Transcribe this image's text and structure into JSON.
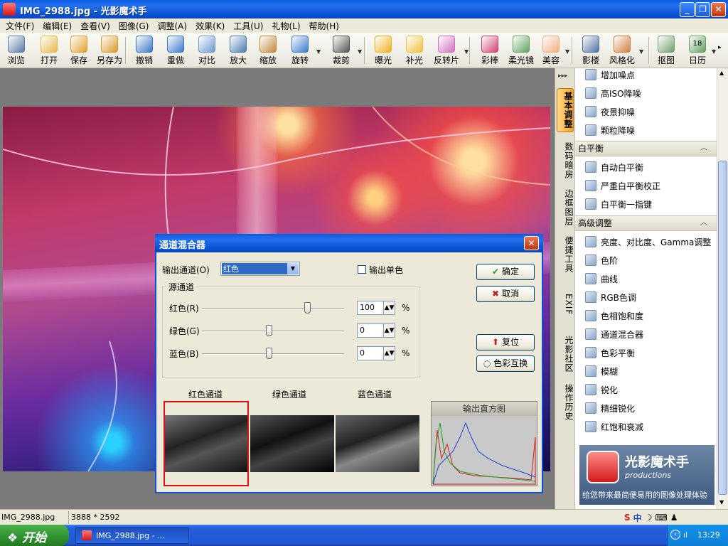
{
  "window": {
    "title": "IMG_2988.jpg - 光影魔术手",
    "min": "_",
    "max": "❐",
    "close": "✕"
  },
  "menu": [
    "文件(F)",
    "编辑(E)",
    "查看(V)",
    "图像(G)",
    "调整(A)",
    "效果(K)",
    "工具(U)",
    "礼物(L)",
    "帮助(H)"
  ],
  "toolbar": [
    {
      "label": "浏览",
      "icon": "eye-icon",
      "color": "#5a7aa8"
    },
    {
      "label": "打开",
      "icon": "folder-icon",
      "color": "#e8b84a"
    },
    {
      "label": "保存",
      "icon": "save-icon",
      "color": "#e0a030"
    },
    {
      "label": "另存为",
      "icon": "save-as-icon",
      "color": "#d89a28"
    },
    {
      "label": "撤销",
      "icon": "undo-icon",
      "color": "#3a78c8"
    },
    {
      "label": "重做",
      "icon": "redo-icon",
      "color": "#3a78c8"
    },
    {
      "label": "对比",
      "icon": "compare-icon",
      "color": "#6a9ad0"
    },
    {
      "label": "放大",
      "icon": "zoom-in-icon",
      "color": "#4a7ab0"
    },
    {
      "label": "缩放",
      "icon": "resize-icon",
      "color": "#c08a3a"
    },
    {
      "label": "旋转",
      "icon": "rotate-icon",
      "color": "#3a78c8"
    },
    {
      "label": "裁剪",
      "icon": "crop-icon",
      "color": "#555555"
    },
    {
      "label": "曝光",
      "icon": "sun-icon",
      "color": "#f0b020"
    },
    {
      "label": "补光",
      "icon": "bulb-icon",
      "color": "#f0c040"
    },
    {
      "label": "反转片",
      "icon": "film-icon",
      "color": "#d070c0"
    },
    {
      "label": "彩棒",
      "icon": "magic-wand-icon",
      "color": "#d04070"
    },
    {
      "label": "柔光镜",
      "icon": "soft-lens-icon",
      "color": "#60a060"
    },
    {
      "label": "美容",
      "icon": "face-icon",
      "color": "#f0b080"
    },
    {
      "label": "影楼",
      "icon": "studio-icon",
      "color": "#5070a0"
    },
    {
      "label": "风格化",
      "icon": "style-icon",
      "color": "#d08040"
    },
    {
      "label": "抠图",
      "icon": "cutout-icon",
      "color": "#70a070"
    },
    {
      "label": "日历",
      "icon": "calendar-icon",
      "color": "#60a060",
      "text": "18"
    }
  ],
  "vtabs": [
    "基本调整",
    "数码暗房",
    "边框图层",
    "便捷工具",
    "EXIF",
    "光影社区",
    "操作历史"
  ],
  "panel": {
    "noise_items": [
      "增加噪点",
      "高ISO降噪",
      "夜景抑噪",
      "颗粒降噪"
    ],
    "wb_head": "白平衡",
    "wb_items": [
      "自动白平衡",
      "严重白平衡校正",
      "白平衡一指键"
    ],
    "adv_head": "高级调整",
    "adv_items": [
      "亮度、对比度、Gamma调整",
      "色阶",
      "曲线",
      "RGB色调",
      "色相饱和度",
      "通道混合器",
      "色彩平衡",
      "模糊",
      "锐化",
      "精细锐化",
      "红饱和衰减"
    ],
    "brand_title": "光影魔术手",
    "brand_sub": "productions",
    "brand_slogan": "给您带来最简便易用的图像处理体验",
    "collapse": "︿"
  },
  "dialog": {
    "title": "通道混合器",
    "output_channel_label": "输出通道(O)",
    "output_channel_value": "红色",
    "mono_label": "输出单色",
    "ok": "确定",
    "cancel": "取消",
    "reset": "复位",
    "swap": "色彩互换",
    "source_group": "源通道",
    "channels": [
      {
        "label": "红色(R)",
        "value": "100",
        "level": 1.0,
        "percent": "%"
      },
      {
        "label": "绿色(G)",
        "value": "0",
        "level": 0.5,
        "percent": "%"
      },
      {
        "label": "蓝色(B)",
        "value": "0",
        "level": 0.5,
        "percent": "%"
      }
    ],
    "previews": [
      "红色通道",
      "绿色通道",
      "蓝色通道"
    ],
    "histogram_title": "输出直方图"
  },
  "status": {
    "file": "IMG_2988.jpg",
    "size": "3888 * 2592"
  },
  "taskbar": {
    "start": "开始",
    "task": "IMG_2988.jpg - ...",
    "time": "13:29",
    "ime": "中"
  }
}
